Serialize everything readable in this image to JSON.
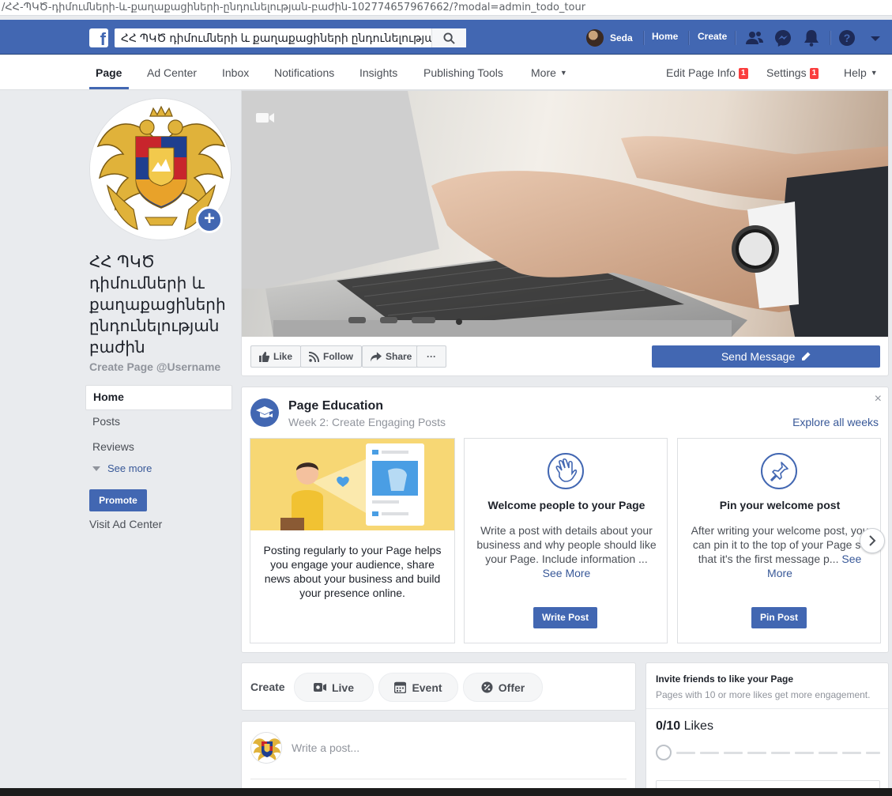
{
  "browser": {
    "url": "/ՀՀ-ՊԿԾ-դիմումների-և-քաղաքացիների-ընդունելության-բաժին-102774657967662/?modal=admin_todo_tour"
  },
  "topbar": {
    "search_value": "ՀՀ ՊԿԾ դիմումների և քաղաքացիների ընդունելության բ...",
    "user_name": "Seda",
    "home_label": "Home",
    "create_label": "Create",
    "icons": [
      "friends-icon",
      "messenger-icon",
      "notifications-icon",
      "help-icon",
      "account-menu-icon"
    ]
  },
  "tabs": {
    "page": "Page",
    "ad_center": "Ad Center",
    "inbox": "Inbox",
    "notifications": "Notifications",
    "insights": "Insights",
    "publishing_tools": "Publishing Tools",
    "more": "More",
    "edit_page_info": "Edit Page Info",
    "edit_page_info_badge": "1",
    "settings": "Settings",
    "settings_badge": "1",
    "help": "Help"
  },
  "sidebar": {
    "page_name": "ՀՀ ՊԿԾ դիմումների և քաղաքացիների ընդունելության բաժին",
    "create_username": "Create Page @Username",
    "nav": [
      {
        "label": "Home",
        "active": true
      },
      {
        "label": "Posts",
        "active": false
      },
      {
        "label": "Reviews",
        "active": false
      }
    ],
    "see_more": "See more",
    "promote": "Promote",
    "visit_ad_center": "Visit Ad Center"
  },
  "cover_actions": {
    "like": "Like",
    "follow": "Follow",
    "share": "Share",
    "more": "···",
    "send_message": "Send Message"
  },
  "education": {
    "title": "Page Education",
    "subtitle": "Week 2: Create Engaging Posts",
    "explore": "Explore all weeks",
    "close": "×",
    "tile1_text": "Posting regularly to your Page helps you engage your audience, share news about your business and build your presence online.",
    "tile2": {
      "title": "Welcome people to your Page",
      "text": "Write a post with details about your business and why people should like your Page. Include information",
      "ellipsis": "...",
      "see_more": "See More",
      "button": "Write Post"
    },
    "tile3": {
      "title": "Pin your welcome post",
      "text": "After writing your welcome post, you can pin it to the top of your Page so that it's the first message p",
      "ellipsis": "...",
      "see_more": "See More",
      "button": "Pin Post"
    }
  },
  "create": {
    "label": "Create",
    "live": "Live",
    "event": "Event",
    "offer": "Offer"
  },
  "composer": {
    "placeholder": "Write a post..."
  },
  "invite": {
    "title": "Invite friends to like your Page",
    "subtitle": "Pages with 10 or more likes get more engagement.",
    "count": "0/10",
    "count_label": "Likes",
    "progress": 0
  },
  "colors": {
    "brand_blue": "#4267b2",
    "badge_red": "#fa3e3e",
    "link_blue": "#385898"
  }
}
